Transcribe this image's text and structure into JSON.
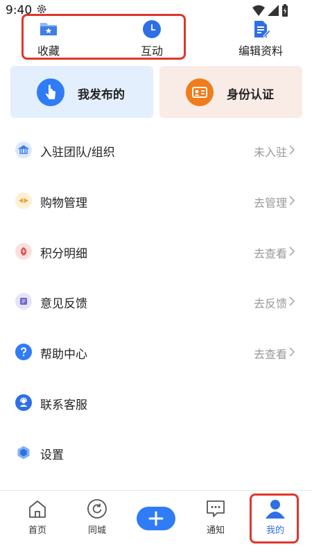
{
  "status_bar": {
    "time": "9:40"
  },
  "top_row": {
    "favorites_label": "收藏",
    "interaction_label": "互动",
    "edit_profile_label": "编辑资料"
  },
  "cards": {
    "my_posts_label": "我发布的",
    "identity_label": "身份认证"
  },
  "menu": {
    "items": [
      {
        "label": "入驻团队/组织",
        "value": "未入驻",
        "icon": "bank-icon"
      },
      {
        "label": "购物管理",
        "value": "去管理",
        "icon": "shopping-icon"
      },
      {
        "label": "积分明细",
        "value": "去查看",
        "icon": "points-icon"
      },
      {
        "label": "意见反馈",
        "value": "去反馈",
        "icon": "feedback-icon"
      },
      {
        "label": "帮助中心",
        "value": "去查看",
        "icon": "help-icon"
      },
      {
        "label": "联系客服",
        "value": "",
        "icon": "customer-service-icon"
      },
      {
        "label": "设置",
        "value": "",
        "icon": "settings-icon"
      }
    ]
  },
  "bottom_nav": {
    "home_label": "首页",
    "city_label": "同城",
    "notify_label": "通知",
    "me_label": "我的"
  },
  "colors": {
    "accent": "#2f7cf6",
    "highlight": "#e0352b",
    "card_blue_bg": "#e3effc",
    "card_orange_bg": "#f9ece6",
    "orange": "#f07c1b"
  }
}
